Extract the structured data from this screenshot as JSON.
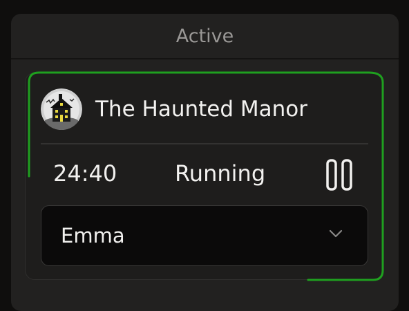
{
  "panel": {
    "title": "Active"
  },
  "room": {
    "name": "The Haunted Manor",
    "avatar_icon": "haunted-house-icon",
    "timer": "24:40",
    "status": "Running",
    "action_icon": "pause-icon",
    "accent_color": "#1fa01f"
  },
  "assignee": {
    "selected": "Emma",
    "icon": "chevron-down-icon"
  }
}
